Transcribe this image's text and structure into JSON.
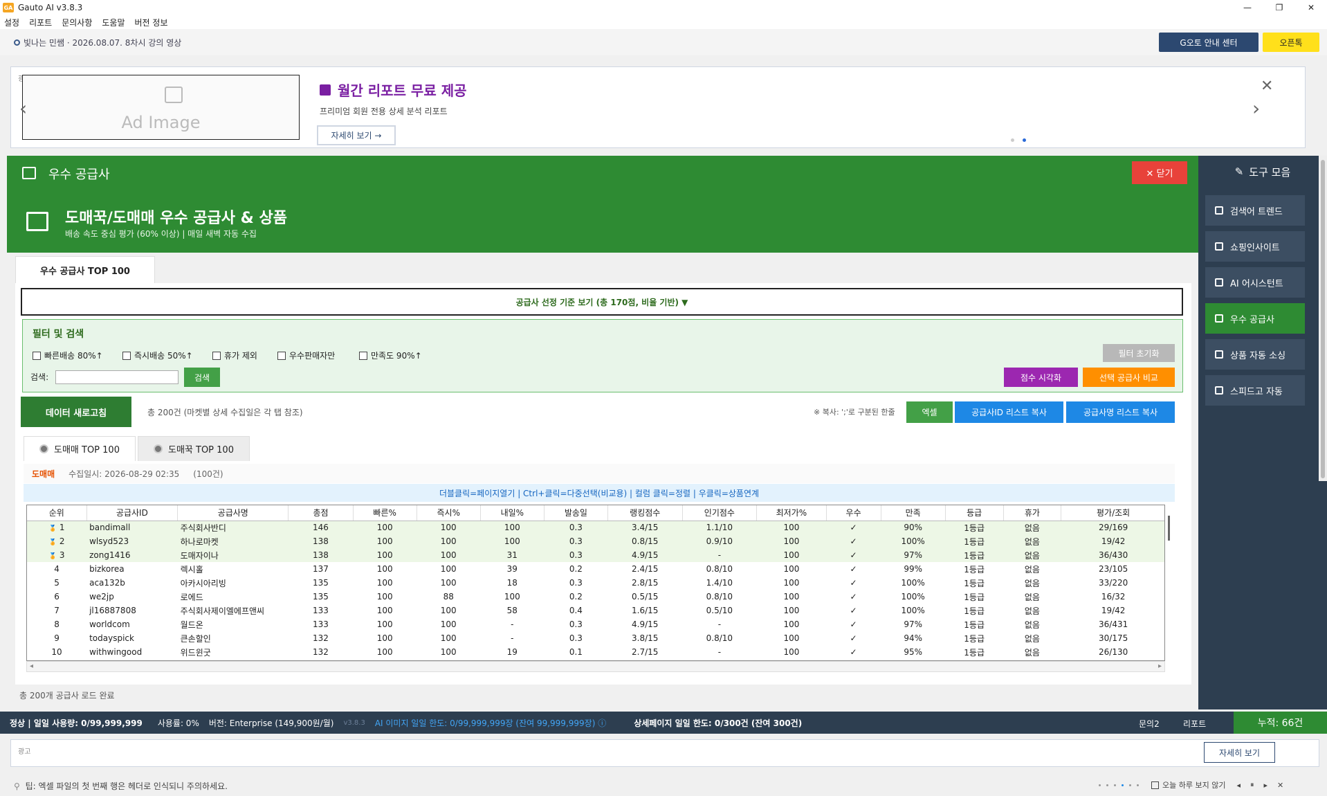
{
  "window": {
    "title": "Gauto AI v3.8.3",
    "logo": "GA",
    "min": "—",
    "max": "❐",
    "close": "✕"
  },
  "menu": [
    "설정",
    "리포트",
    "문의사항",
    "도움말",
    "버전 정보"
  ],
  "notice": "빛나는 민쌤 · 2026.08.07. 8차시 강의 영상",
  "top_buttons": {
    "guide": "G오토 안내 센터",
    "openchat": "오픈톡"
  },
  "ad": {
    "label": "광고",
    "image_text": "Ad Image",
    "title": "월간 리포트 무료 제공",
    "subtitle": "프리미엄 회원 전용 상세 분석 리포트",
    "more": "자세히 보기 →",
    "prev": "‹",
    "next": "›",
    "close": "✕"
  },
  "header": {
    "title": "우수 공급사",
    "close": "✕ 닫기",
    "big_title": "도매꾹/도매매 우수 공급사 & 상품",
    "subtitle": "배송 속도 중심 평가 (60% 이상) | 매일 새벽 자동 수집"
  },
  "tab_main": "우수 공급사 TOP 100",
  "criteria": "공급사 선정 기준 보기 (총 170점, 비율 기반) ▼",
  "filter": {
    "title": "필터 및 검색",
    "checks": [
      "빠른배송 80%↑",
      "즉시배송 50%↑",
      "휴가 제외",
      "우수판매자만",
      "만족도 90%↑"
    ],
    "search_label": "검색:",
    "search_value": "",
    "search_btn": "검색",
    "reset": "필터 초기화",
    "viz": "점수 시각화",
    "compare": "선택 공급사 비교"
  },
  "toolbar": {
    "refresh": "데이터 새로고침",
    "total": "총 200건 (마켓별 상세 수집일은 각 탭 참조)",
    "copy_info": "※ 복사: ';'로 구분된 한줄",
    "excel": "엑셀",
    "copy_id": "공급사ID 리스트 복사",
    "copy_name": "공급사명 리스트 복사"
  },
  "subtabs": [
    "도매매 TOP 100",
    "도매꾹 TOP 100"
  ],
  "source": {
    "label": "도매매",
    "date": "수집일시: 2026-08-29 02:35",
    "count": "(100건)"
  },
  "hint": "더블클릭=페이지열기 | Ctrl+클릭=다중선택(비교용) | 컬럼 클릭=정렬 | 우클릭=상품연계",
  "table": {
    "columns": [
      "순위",
      "공급사ID",
      "공급사명",
      "총점",
      "빠른%",
      "즉시%",
      "내일%",
      "발송일",
      "랭킹점수",
      "인기점수",
      "최저가%",
      "우수",
      "만족",
      "등급",
      "휴가",
      "평가/조회"
    ],
    "rows": [
      [
        "1",
        "bandimall",
        "주식회사반디",
        "146",
        "100",
        "100",
        "100",
        "0.3",
        "3.4/15",
        "1.1/10",
        "100",
        "✓",
        "90%",
        "1등급",
        "없음",
        "29/169"
      ],
      [
        "2",
        "wlsyd523",
        "하나로마켓",
        "138",
        "100",
        "100",
        "100",
        "0.3",
        "0.8/15",
        "0.9/10",
        "100",
        "✓",
        "100%",
        "1등급",
        "없음",
        "19/42"
      ],
      [
        "3",
        "zong1416",
        "도매자이나",
        "138",
        "100",
        "100",
        "31",
        "0.3",
        "4.9/15",
        "-",
        "100",
        "✓",
        "97%",
        "1등급",
        "없음",
        "36/430"
      ],
      [
        "4",
        "bizkorea",
        "렉시홀",
        "137",
        "100",
        "100",
        "39",
        "0.2",
        "2.4/15",
        "0.8/10",
        "100",
        "✓",
        "99%",
        "1등급",
        "없음",
        "23/105"
      ],
      [
        "5",
        "aca132b",
        "아카시아리빙",
        "135",
        "100",
        "100",
        "18",
        "0.3",
        "2.8/15",
        "1.4/10",
        "100",
        "✓",
        "100%",
        "1등급",
        "없음",
        "33/220"
      ],
      [
        "6",
        "we2jp",
        "로에드",
        "135",
        "100",
        "88",
        "100",
        "0.2",
        "0.5/15",
        "0.8/10",
        "100",
        "✓",
        "100%",
        "1등급",
        "없음",
        "16/32"
      ],
      [
        "7",
        "jl16887808",
        "주식회사제이엘에프앤씨",
        "133",
        "100",
        "100",
        "58",
        "0.4",
        "1.6/15",
        "0.5/10",
        "100",
        "✓",
        "100%",
        "1등급",
        "없음",
        "19/42"
      ],
      [
        "8",
        "worldcom",
        "월드온",
        "133",
        "100",
        "100",
        "-",
        "0.3",
        "4.9/15",
        "-",
        "100",
        "✓",
        "97%",
        "1등급",
        "없음",
        "36/431"
      ],
      [
        "9",
        "todayspick",
        "큰손할인",
        "132",
        "100",
        "100",
        "-",
        "0.3",
        "3.8/15",
        "0.8/10",
        "100",
        "✓",
        "94%",
        "1등급",
        "없음",
        "30/175"
      ],
      [
        "10",
        "withwingood",
        "위드윈굿",
        "132",
        "100",
        "100",
        "19",
        "0.1",
        "2.7/15",
        "-",
        "100",
        "✓",
        "95%",
        "1등급",
        "없음",
        "26/130"
      ]
    ],
    "medal": "🏅"
  },
  "hscroll": {
    "left": "◂",
    "right": "▸"
  },
  "status_loaded": "총 200개 공급사 로드 완료",
  "sidebar": {
    "title": "도구 모음",
    "items": [
      "검색어 트렌드",
      "쇼핑인사이트",
      "AI 어시스턴트",
      "우수 공급사",
      "상품 자동 소싱",
      "스피드고 자동"
    ]
  },
  "statusbar": {
    "usage": "정상 | 일일 사용량: 0/99,999,999",
    "rate": "사용률: 0%",
    "version": "버전: Enterprise (149,900원/월)",
    "ver2": "v3.8.3",
    "ai": "AI 이미지 일일 한도: 0/99,999,999장 (잔여 99,999,999장) ⓘ",
    "detail": "상세페이지 일일 한도: 0/300건 (잔여 300건)",
    "inquiry": "문의2",
    "report": "리포트",
    "total": "누적: 66건"
  },
  "ad2": {
    "label": "광고",
    "more": "자세히 보기"
  },
  "tip": "팁: 엑셀 파일의 첫 번째 행은 헤더로 인식되니 주의하세요.",
  "tipnav": {
    "hide": "오늘 하루 보지 않기",
    "prev": "◂",
    "pause": "⏸",
    "next": "▸",
    "close": "✕"
  }
}
